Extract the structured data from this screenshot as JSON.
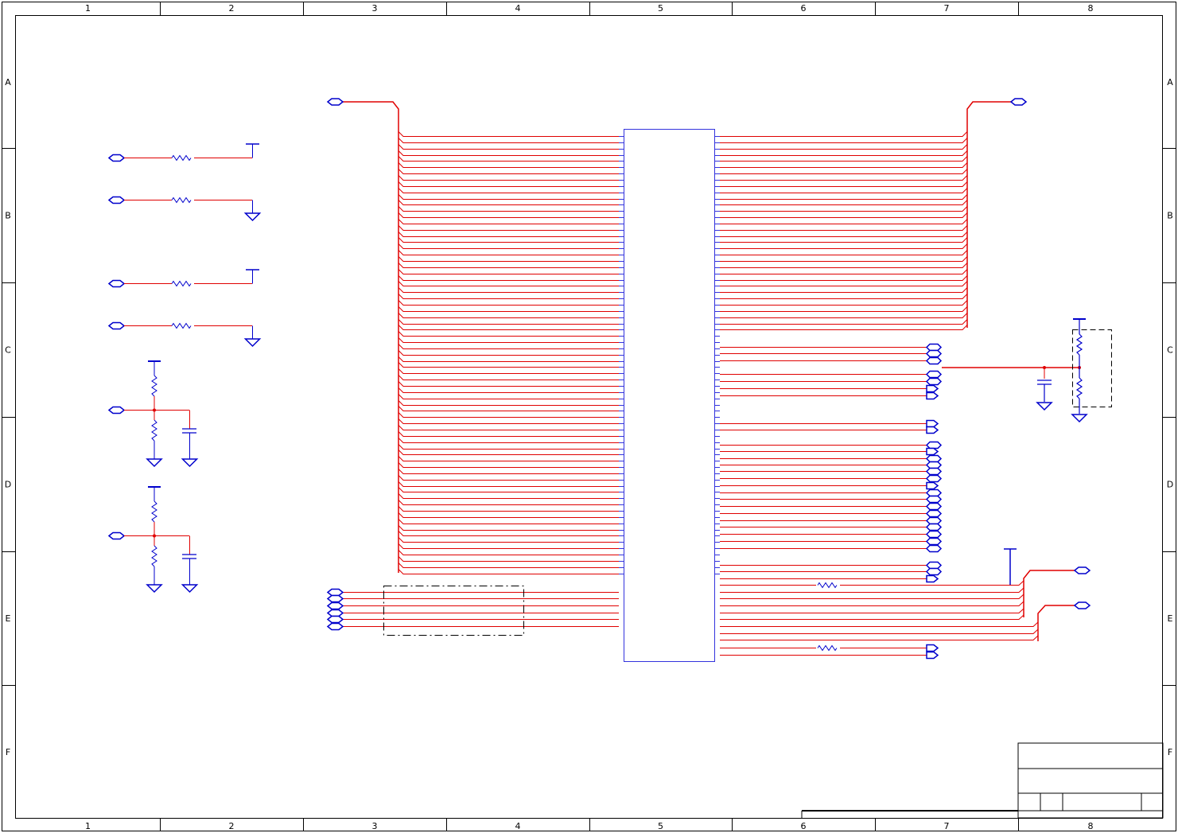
{
  "frame": {
    "columns": [
      "1",
      "2",
      "3",
      "4",
      "5",
      "6",
      "7",
      "8"
    ],
    "rows": [
      "A",
      "B",
      "C",
      "D",
      "E",
      "F"
    ]
  },
  "colors": {
    "wire": "#e00000",
    "symbol": "#0000cc",
    "ic_outline": "#3333dd",
    "frame": "#000000"
  }
}
